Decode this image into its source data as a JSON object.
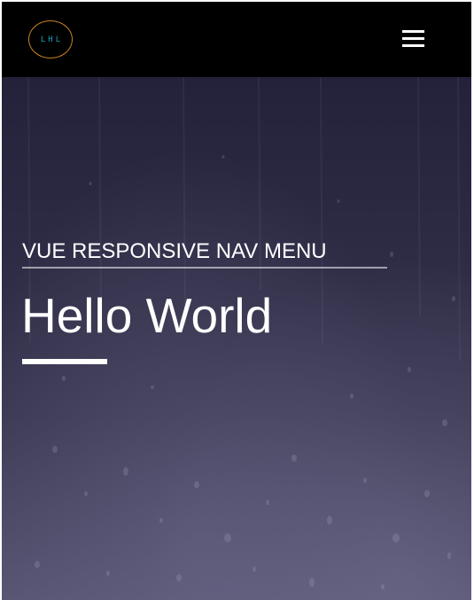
{
  "navbar": {
    "logo_text": "LHL",
    "menu_icon": "hamburger-menu-icon"
  },
  "hero": {
    "subtitle": "VUE RESPONSIVE NAV MENU",
    "headline": "Hello World",
    "background": "rainy-window-image"
  },
  "colors": {
    "navbar_bg": "#000000",
    "logo_ring": "#c8861e",
    "logo_text": "#1fa0b8",
    "hero_text": "#ffffff",
    "hero_bg": "#2e2c45"
  }
}
